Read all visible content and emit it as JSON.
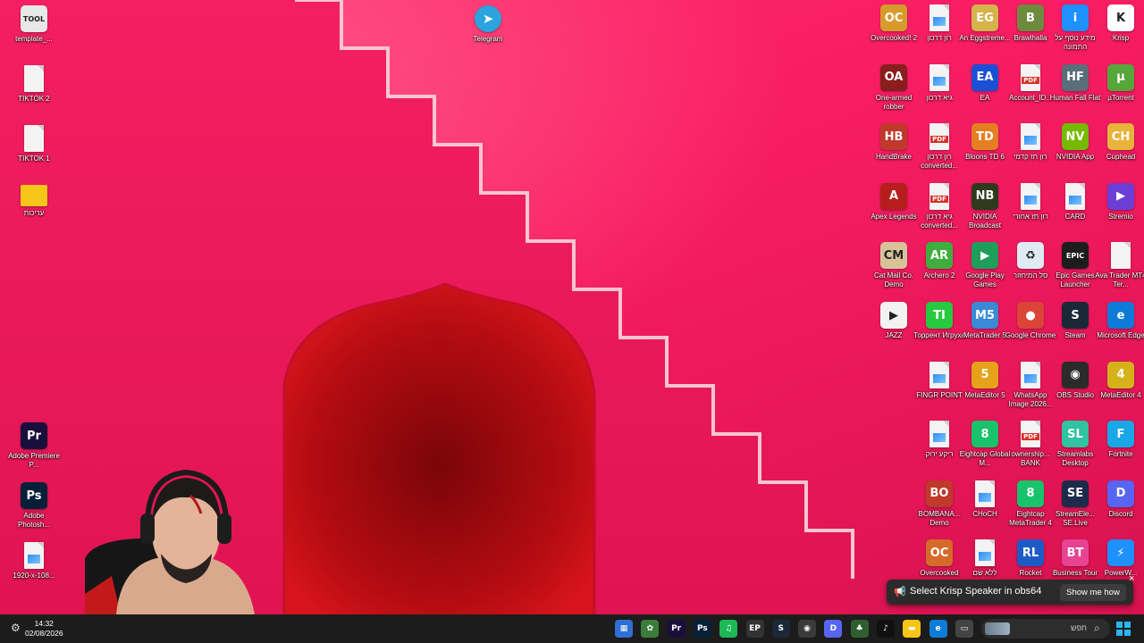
{
  "desktop": {
    "left_icons": [
      {
        "label": "template_...",
        "icon": "tool-app-icon",
        "color": "#e8e8e8",
        "glyph": "TOOL"
      },
      {
        "label": "TIKTOK 2",
        "icon": "text-file-icon"
      },
      {
        "label": "TIKTOK 1",
        "icon": "text-file-icon"
      },
      {
        "label": "עריכות",
        "icon": "folder-icon",
        "color": "#f5c518"
      },
      {
        "label": "Adobe Premiere P...",
        "icon": "premiere-icon",
        "color": "#1a0f3c",
        "glyph": "Pr"
      },
      {
        "label": "Adobe Photosh...",
        "icon": "photoshop-icon",
        "color": "#06203a",
        "glyph": "Ps"
      },
      {
        "label": "1920-x-108...",
        "icon": "image-file-icon"
      }
    ],
    "telegram": {
      "label": "Telegram",
      "icon": "telegram-icon",
      "color": "#2aa3df"
    },
    "grid_rows": [
      [
        {
          "label": "Overcooked! 2",
          "icon": "overcooked2-icon",
          "color": "#d89a2b",
          "glyph": "OC"
        },
        {
          "label": "רון דרכון",
          "icon": "image-file-icon"
        },
        {
          "label": "An Eggstreme...",
          "icon": "egg-game-icon",
          "color": "#d6b24a",
          "glyph": "EG"
        },
        {
          "label": "Brawlhalla",
          "icon": "brawlhalla-icon",
          "color": "#6e8b3d",
          "glyph": "B"
        },
        {
          "label": "מידע נוסף על התמונה",
          "icon": "info-icon",
          "color": "#1e90ff",
          "glyph": "i"
        },
        {
          "label": "Krisp",
          "icon": "krisp-icon",
          "color": "#ffffff",
          "glyph": "K"
        }
      ],
      [
        {
          "label": "One-armed robber",
          "icon": "slot-game-icon",
          "color": "#8a1d1d",
          "glyph": "OA"
        },
        {
          "label": "גיא דרכון",
          "icon": "image-file-icon"
        },
        {
          "label": "EA",
          "icon": "ea-icon",
          "color": "#1b4fd6",
          "glyph": "EA"
        },
        {
          "label": "Account_ID...",
          "icon": "pdf-file-icon"
        },
        {
          "label": "Human Fall Flat",
          "icon": "human-fall-flat-icon",
          "color": "#5a6e7a",
          "glyph": "HF"
        },
        {
          "label": "µTorrent",
          "icon": "utorrent-icon",
          "color": "#57a639",
          "glyph": "µ"
        }
      ],
      [
        {
          "label": "HandBrake",
          "icon": "handbrake-icon",
          "color": "#c0392b",
          "glyph": "HB"
        },
        {
          "label": "רון דרכון converted...",
          "icon": "pdf-file-icon"
        },
        {
          "label": "Bloons TD 6",
          "icon": "bloons-icon",
          "color": "#e67e22",
          "glyph": "TD"
        },
        {
          "label": "רון תז קדמי",
          "icon": "image-file-icon"
        },
        {
          "label": "NVIDIA App",
          "icon": "nvidia-icon",
          "color": "#76b900",
          "glyph": "NV"
        },
        {
          "label": "Cuphead",
          "icon": "cuphead-icon",
          "color": "#e8b33a",
          "glyph": "CH"
        }
      ],
      [
        {
          "label": "Apex Legends",
          "icon": "apex-icon",
          "color": "#b81d1d",
          "glyph": "A"
        },
        {
          "label": "גיא דרכון converted...",
          "icon": "pdf-file-icon"
        },
        {
          "label": "NVIDIA Broadcast",
          "icon": "nvidia-broadcast-icon",
          "color": "#2d3b1c",
          "glyph": "NB"
        },
        {
          "label": "רון תז אחורי",
          "icon": "image-file-icon"
        },
        {
          "label": "CARD",
          "icon": "image-file-icon"
        },
        {
          "label": "Stremio",
          "icon": "stremio-icon",
          "color": "#6b3fd6",
          "glyph": "▶"
        }
      ],
      [
        {
          "label": "Cat Mail Co. Demo",
          "icon": "cat-mail-icon",
          "color": "#d9c29a",
          "glyph": "CM"
        },
        {
          "label": "Archero 2",
          "icon": "archero-icon",
          "color": "#3fae3f",
          "glyph": "AR"
        },
        {
          "label": "Google Play Games",
          "icon": "google-play-games-icon",
          "color": "#1f9e5a",
          "glyph": "▶"
        },
        {
          "label": "סל המיחזור",
          "icon": "recycle-bin-icon",
          "color": "#dfeaf2",
          "glyph": "♻"
        },
        {
          "label": "Epic Games Launcher",
          "icon": "epic-games-icon",
          "color": "#1d1d1d",
          "glyph": "EPIC"
        },
        {
          "label": "Ava Trader MT4 Ter...",
          "icon": "text-file-icon"
        }
      ],
      [
        {
          "label": "JAZZ",
          "icon": "jazz-icon",
          "color": "#f2f2f2",
          "glyph": "▶"
        },
        {
          "label": "Торрент Игруха",
          "icon": "torrent-igruha-icon",
          "color": "#27c93f",
          "glyph": "TI"
        },
        {
          "label": "MetaTrader 5",
          "icon": "metatrader5-icon",
          "color": "#3a8ad6",
          "glyph": "M5"
        },
        {
          "label": "Google Chrome",
          "icon": "chrome-icon",
          "color": "#db4437",
          "glyph": "●"
        },
        {
          "label": "Steam",
          "icon": "steam-icon",
          "color": "#1b2838",
          "glyph": "S"
        },
        {
          "label": "Microsoft Edge",
          "icon": "edge-icon",
          "color": "#0f7bd8",
          "glyph": "e"
        }
      ],
      [
        {
          "label": "FINGR POINT",
          "icon": "image-file-icon"
        },
        {
          "label": "MetaEditor 5",
          "icon": "metaeditor5-icon",
          "color": "#e6a21a",
          "glyph": "5"
        },
        {
          "label": "WhatsApp Image 2026...",
          "icon": "image-file-icon"
        },
        {
          "label": "OBS Studio",
          "icon": "obs-icon",
          "color": "#2b2b2b",
          "glyph": "◉"
        },
        {
          "label": "MetaEditor 4",
          "icon": "metaeditor4-icon",
          "color": "#d6b21a",
          "glyph": "4"
        }
      ],
      [
        {
          "label": "ריקע ירוק",
          "icon": "image-file-icon"
        },
        {
          "label": "Eightcap Global M...",
          "icon": "eightcap-icon",
          "color": "#18c36b",
          "glyph": "8"
        },
        {
          "label": "ownership... BANK",
          "icon": "pdf-file-icon"
        },
        {
          "label": "Streamlabs Desktop",
          "icon": "streamlabs-icon",
          "color": "#31c3a2",
          "glyph": "SL"
        },
        {
          "label": "Fortnite",
          "icon": "fortnite-icon",
          "color": "#1aa7e8",
          "glyph": "F"
        }
      ],
      [
        {
          "label": "BOMBANA... Demo",
          "icon": "bombana-icon",
          "color": "#c0392b",
          "glyph": "BO"
        },
        {
          "label": "CHoCH",
          "icon": "image-file-icon"
        },
        {
          "label": "Eightcap MetaTrader 4",
          "icon": "eightcap-mt4-icon",
          "color": "#18c36b",
          "glyph": "8"
        },
        {
          "label": "StreamEle... SE.Live",
          "icon": "streamelements-icon",
          "color": "#1d2a4a",
          "glyph": "SE"
        },
        {
          "label": "Discord",
          "icon": "discord-icon",
          "color": "#5865f2",
          "glyph": "D"
        }
      ],
      [
        {
          "label": "Overcooked",
          "icon": "overcooked-icon",
          "color": "#d66a2b",
          "glyph": "OC"
        },
        {
          "label": "ללא שם",
          "icon": "image-file-icon"
        },
        {
          "label": "Rocket",
          "icon": "rocket-league-icon",
          "color": "#1e5bc6",
          "glyph": "RL"
        },
        {
          "label": "Business Tour",
          "icon": "business-tour-icon",
          "color": "#e84393",
          "glyph": "BT"
        },
        {
          "label": "PowerW...",
          "icon": "powerw-icon",
          "color": "#1e90ff",
          "glyph": "⚡"
        }
      ]
    ]
  },
  "notification": {
    "text": "Select Krisp Speaker in obs64",
    "button": "Show me how",
    "close": "×"
  },
  "taskbar": {
    "time": "14:32",
    "date": "02/08/2026",
    "search_placeholder": "חפש",
    "apps": [
      {
        "name": "calculator-taskbar-icon",
        "color": "#2f6fd6",
        "glyph": "▦"
      },
      {
        "name": "app-green-taskbar-icon",
        "color": "#3a7d3a",
        "glyph": "✿"
      },
      {
        "name": "premiere-taskbar-icon",
        "color": "#1a0f3c",
        "glyph": "Pr"
      },
      {
        "name": "photoshop-taskbar-icon",
        "color": "#06203a",
        "glyph": "Ps"
      },
      {
        "name": "spotify-taskbar-icon",
        "color": "#1db954",
        "glyph": "♫"
      },
      {
        "name": "epic-taskbar-icon",
        "color": "#333333",
        "glyph": "EP"
      },
      {
        "name": "steam-taskbar-icon",
        "color": "#1b2838",
        "glyph": "S"
      },
      {
        "name": "obs-taskbar-icon",
        "color": "#3a3a3a",
        "glyph": "◉"
      },
      {
        "name": "discord-taskbar-icon",
        "color": "#5865f2",
        "glyph": "D"
      },
      {
        "name": "game-taskbar-icon",
        "color": "#2f5f2f",
        "glyph": "♣"
      },
      {
        "name": "tiktok-taskbar-icon",
        "color": "#111111",
        "glyph": "♪"
      },
      {
        "name": "explorer-taskbar-icon",
        "color": "#f5c518",
        "glyph": "▬"
      },
      {
        "name": "edge-taskbar-icon",
        "color": "#0f7bd8",
        "glyph": "e"
      },
      {
        "name": "task-view-taskbar-icon",
        "color": "#444444",
        "glyph": "▭"
      }
    ]
  }
}
